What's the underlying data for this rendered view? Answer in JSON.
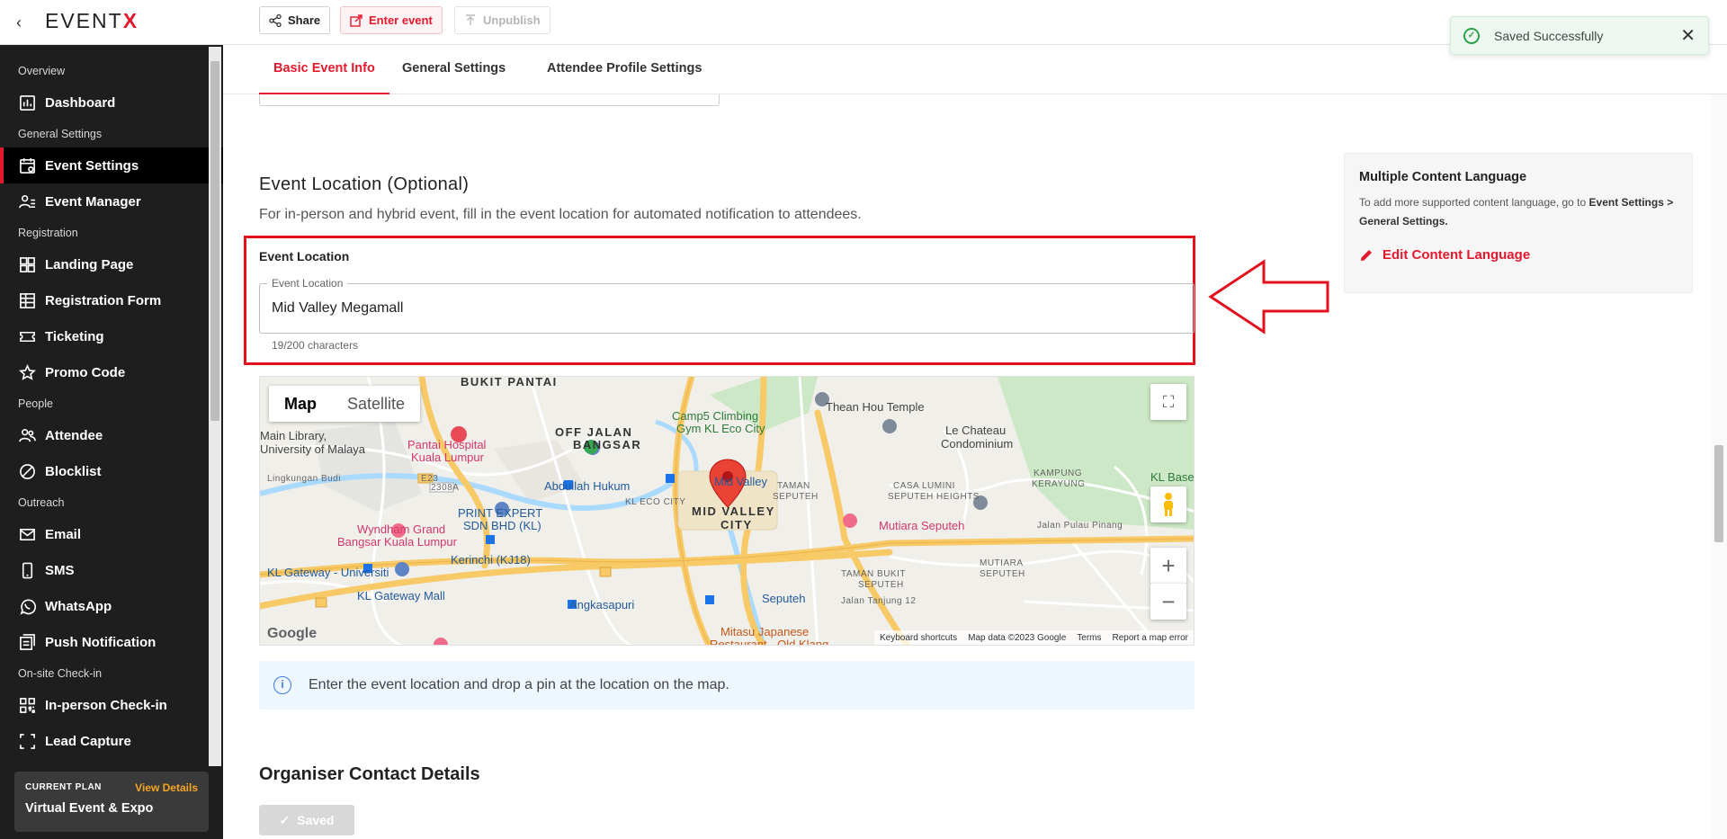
{
  "topbar": {
    "logo_text": "EVENT",
    "logo_accent": "X",
    "share_label": "Share",
    "enter_label": "Enter event",
    "unpublish_label": "Unpublish"
  },
  "toast": {
    "text": "Saved Successfully"
  },
  "sidebar": {
    "sections": [
      {
        "title": "Overview",
        "items": [
          {
            "label": "Dashboard",
            "icon": "dashboard-icon"
          }
        ]
      },
      {
        "title": "General Settings",
        "items": [
          {
            "label": "Event Settings",
            "icon": "event-settings-icon",
            "active": true
          },
          {
            "label": "Event Manager",
            "icon": "event-manager-icon"
          }
        ]
      },
      {
        "title": "Registration",
        "items": [
          {
            "label": "Landing Page",
            "icon": "landing-page-icon"
          },
          {
            "label": "Registration Form",
            "icon": "registration-form-icon"
          },
          {
            "label": "Ticketing",
            "icon": "ticket-icon"
          },
          {
            "label": "Promo Code",
            "icon": "star-icon"
          }
        ]
      },
      {
        "title": "People",
        "items": [
          {
            "label": "Attendee",
            "icon": "attendee-icon"
          },
          {
            "label": "Blocklist",
            "icon": "block-icon"
          }
        ]
      },
      {
        "title": "Outreach",
        "items": [
          {
            "label": "Email",
            "icon": "email-icon"
          },
          {
            "label": "SMS",
            "icon": "sms-icon"
          },
          {
            "label": "WhatsApp",
            "icon": "whatsapp-icon"
          },
          {
            "label": "Push Notification",
            "icon": "push-notification-icon"
          }
        ]
      },
      {
        "title": "On-site Check-in",
        "items": [
          {
            "label": "In-person Check-in",
            "icon": "qr-code-icon"
          },
          {
            "label": "Lead Capture",
            "icon": "lead-capture-icon"
          }
        ]
      }
    ],
    "plan": {
      "label": "CURRENT PLAN",
      "link": "View Details",
      "name": "Virtual Event & Expo"
    }
  },
  "tabs": [
    {
      "label": "Basic Event Info",
      "active": true
    },
    {
      "label": "General Settings"
    },
    {
      "label": "Attendee Profile Settings"
    }
  ],
  "location": {
    "title": "Event Location (Optional)",
    "description": "For in-person and hybrid event, fill in the event location for automated notification to attendees.",
    "label": "Event Location",
    "field_legend": "Event Location",
    "value": "Mid Valley Megamall",
    "char_count": "19/200 characters"
  },
  "map": {
    "type_buttons": [
      "Map",
      "Satellite"
    ],
    "labels": {
      "bukit_pantai": "BUKIT PANTAI",
      "off_jalan": "OFF JALAN",
      "bangsar": "BANGSAR",
      "camp5": "Camp5 Climbing",
      "camp5b": "Gym KL Eco City",
      "thean_hou": "Thean Hou Temple",
      "chateau": "Le Chateau",
      "chateau2": "Condominium",
      "main_lib": "Main Library,",
      "main_lib2": "University of Malaya",
      "pantai_hosp": "Pantai Hospital",
      "pantai_hosp2": "Kuala Lumpur",
      "abdullah": "Abdullah Hukum",
      "kl_eco": "KL ECO CITY",
      "mid_valley": "MID VALLEY",
      "city": "CITY",
      "midvalley_st": "Mid Valley",
      "taman_seputeh": "TAMAN",
      "taman_seputeh2": "SEPUTEH",
      "casa": "CASA LUMINI",
      "casa2": "SEPUTEH HEIGHTS",
      "kampung": "KAMPUNG",
      "kampung2": "KERAYUNG",
      "kl_base": "KL Base Ma",
      "print_expert": "PRINT EXPERT",
      "print_expert2": "SDN BHD (KL)",
      "wyndham": "Wyndham Grand",
      "wyndham2": "Bangsar Kuala Lumpur",
      "kerinchi": "Kerinchi (KJ18)",
      "mutiara": "Mutiara Seputeh",
      "kl_gateway_uni": "KL Gateway - Universiti",
      "kl_gateway_mall": "KL Gateway Mall",
      "taman_bukit": "TAMAN BUKIT",
      "taman_bukit2": "SEPUTEH",
      "mutiara_seputeh": "MUTIARA",
      "mutiara_seputeh2": "SEPUTEH",
      "angkasapuri": "Angkasapuri",
      "seputeh": "Seputeh",
      "mitasu": "Mitasu Japanese",
      "mitasu2": "Restaurant - Old Klang",
      "jalan_pulau": "Jalan Pulau Pinang",
      "jalan_tanjung": "Jalan Tanjung 12",
      "lingkungan": "Lingkungan Budi",
      "e23": "E23",
      "r2308": "2308A"
    },
    "footer": [
      "Keyboard shortcuts",
      "Map data ©2023 Google",
      "Terms",
      "Report a map error"
    ],
    "google_label": "Google"
  },
  "info": {
    "text": "Enter the event location and drop a pin at the location on the map."
  },
  "organiser": {
    "title": "Organiser Contact Details"
  },
  "saved_button": "Saved",
  "lang_panel": {
    "title": "Multiple Content Language",
    "desc_1": "To add more supported content language, go to ",
    "desc_bold": "Event Settings > General Settings.",
    "edit_label": "Edit Content Language"
  },
  "colors": {
    "accent": "#e5192e",
    "success": "#2ca24b",
    "info": "#3d7bd9",
    "sidebar_bg": "#1e1e1e"
  }
}
